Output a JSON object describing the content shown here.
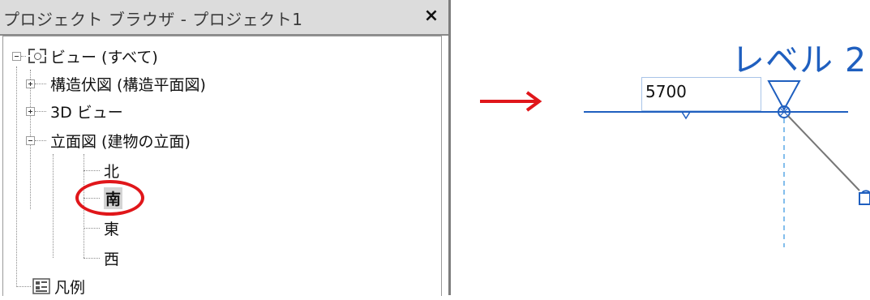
{
  "browser": {
    "title": "プロジェクト ブラウザ - プロジェクト1",
    "close_label": "×",
    "root_label": "ビュー (すべて)",
    "items": [
      {
        "label": "構造伏図 (構造平面図)",
        "expanded": false
      },
      {
        "label": "3D ビュー",
        "expanded": false
      },
      {
        "label": "立面図 (建物の立面)",
        "expanded": true
      }
    ],
    "elevations": [
      "北",
      "南",
      "東",
      "西"
    ],
    "selected_elevation": "南",
    "legend_label": "凡例"
  },
  "annotation": {
    "circle_color": "#e0161a",
    "arrow_color": "#e0161a"
  },
  "level": {
    "name": "レベル 2",
    "elevation_value": "5700",
    "accent_color": "#1f5fbf"
  }
}
